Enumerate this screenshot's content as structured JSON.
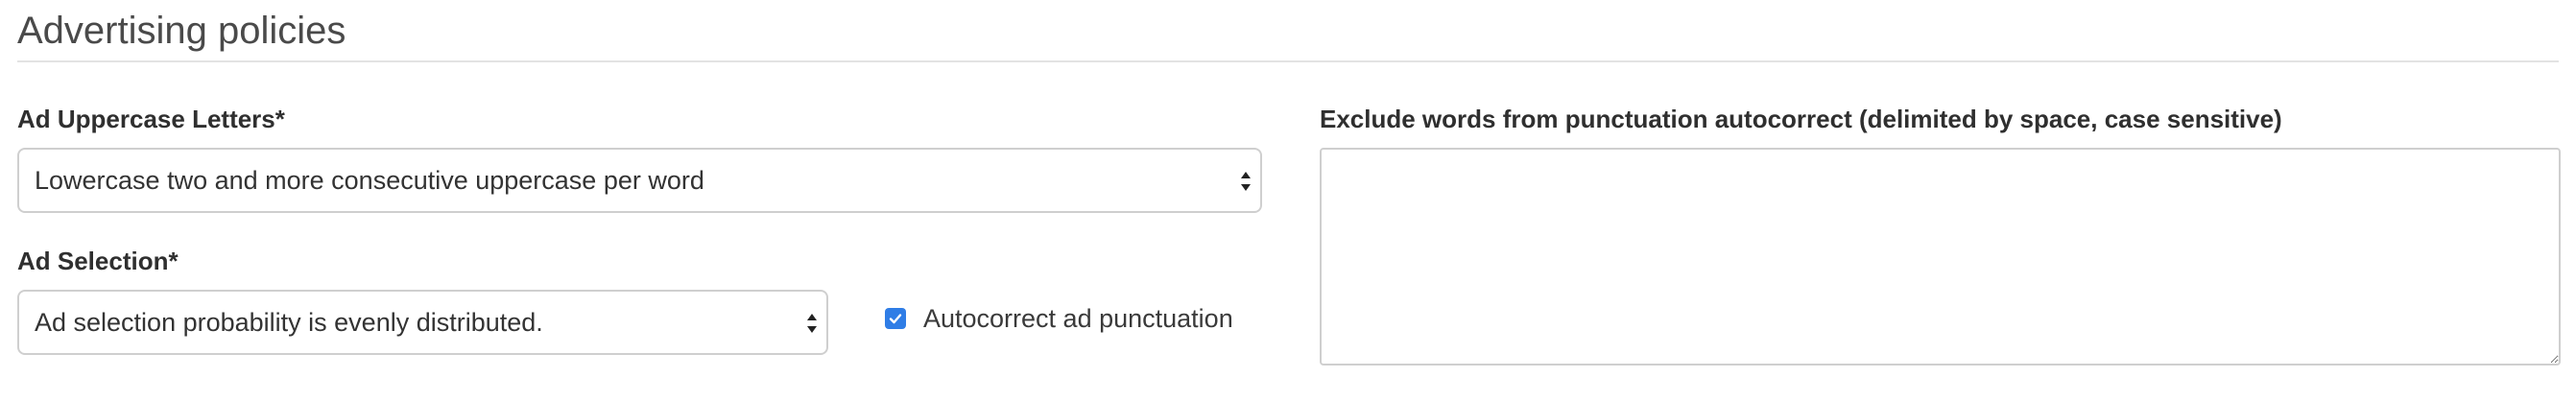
{
  "section": {
    "title": "Advertising policies"
  },
  "uppercase": {
    "label": "Ad Uppercase Letters*",
    "value": "Lowercase two and more consecutive uppercase per word",
    "icon": "select-caret-icon"
  },
  "selection": {
    "label": "Ad Selection*",
    "value": "Ad selection probability is evenly distributed.",
    "icon": "select-caret-icon"
  },
  "punctuation": {
    "checkbox_label": "Autocorrect ad punctuation",
    "checked": true,
    "icon": "checkmark-icon",
    "accent": "#2f7de6"
  },
  "exclude": {
    "label": "Exclude words from punctuation autocorrect (delimited by space, case sensitive)",
    "value": ""
  }
}
